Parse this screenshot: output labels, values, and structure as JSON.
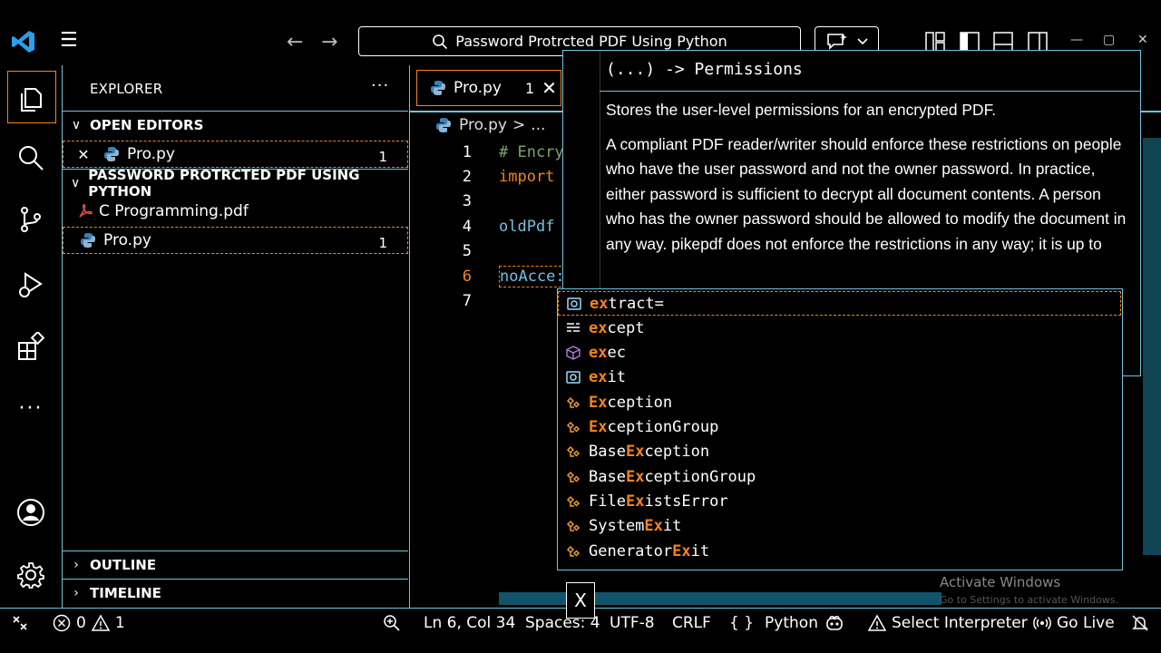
{
  "titlebar": {
    "search_text": "Password Protrcted PDF Using Python",
    "back_icon": "arrow-left-icon",
    "forward_icon": "arrow-right-icon",
    "minimize": "—",
    "maximize": "▢",
    "close": "✕"
  },
  "sidebar": {
    "title": "EXPLORER",
    "more": "···",
    "open_editors": {
      "header": "OPEN EDITORS",
      "items": [
        {
          "close": "✕",
          "label": "Pro.py",
          "badge": "1"
        }
      ]
    },
    "folder": {
      "header": "PASSWORD PROTRCTED PDF USING PYTHON",
      "items": [
        {
          "label": "C Programming.pdf",
          "badge": ""
        },
        {
          "label": "Pro.py",
          "badge": "1"
        }
      ]
    },
    "outline": "OUTLINE",
    "timeline": "TIMELINE"
  },
  "editor": {
    "tab": {
      "label": "Pro.py",
      "badge": "1",
      "close": "✕"
    },
    "breadcrumb": {
      "file": "Pro.py",
      "sep": ">",
      "rest": "..."
    },
    "line_numbers": [
      "1",
      "2",
      "3",
      "4",
      "5",
      "6",
      "7"
    ],
    "lines": [
      "# Encry",
      "import",
      "",
      "oldPdf",
      "",
      "noAcce:",
      ""
    ]
  },
  "hover": {
    "signature": "(...) -> Permissions",
    "paragraphs": [
      "Stores the user-level permissions for an encrypted PDF.",
      "A compliant PDF reader/writer should enforce these restrictions on people who have the user password and not the owner password. In practice, either password is sufficient to decrypt all document contents. A person who has the owner password should be allowed to modify the document in any way. pikepdf does not enforce the restrictions in any way; it is up to"
    ]
  },
  "suggest": [
    {
      "kind": "variable",
      "match": "ex",
      "pre": "",
      "post": "tract="
    },
    {
      "kind": "keyword",
      "match": "ex",
      "pre": "",
      "post": "cept"
    },
    {
      "kind": "module",
      "match": "ex",
      "pre": "",
      "post": "ec"
    },
    {
      "kind": "variable",
      "match": "ex",
      "pre": "",
      "post": "it"
    },
    {
      "kind": "class",
      "match": "Ex",
      "pre": "",
      "post": "ception"
    },
    {
      "kind": "class",
      "match": "Ex",
      "pre": "",
      "post": "ceptionGroup"
    },
    {
      "kind": "class",
      "match": "Ex",
      "pre": "Base",
      "post": "ception"
    },
    {
      "kind": "class",
      "match": "Ex",
      "pre": "Base",
      "post": "ceptionGroup"
    },
    {
      "kind": "class",
      "match": "Ex",
      "pre": "File",
      "post": "istsError"
    },
    {
      "kind": "class",
      "match": "Ex",
      "pre": "System",
      "post": "it"
    },
    {
      "kind": "class",
      "match": "Ex",
      "pre": "Generator",
      "post": "it"
    }
  ],
  "watermark": {
    "line1": "Activate Windows",
    "line2": "Go to Settings to activate Windows."
  },
  "close_box": "X",
  "statusbar": {
    "errors": "0",
    "warnings": "1",
    "position": "Ln 6, Col 34",
    "spaces": "Spaces: 4",
    "encoding": "UTF-8",
    "eol": "CRLF",
    "language_braces": "{ }",
    "language": "Python",
    "interpreter": "Select Interpreter",
    "golive": "Go Live"
  },
  "colors": {
    "accent": "#f38518",
    "border": "#6fc3df",
    "background": "#000000"
  }
}
